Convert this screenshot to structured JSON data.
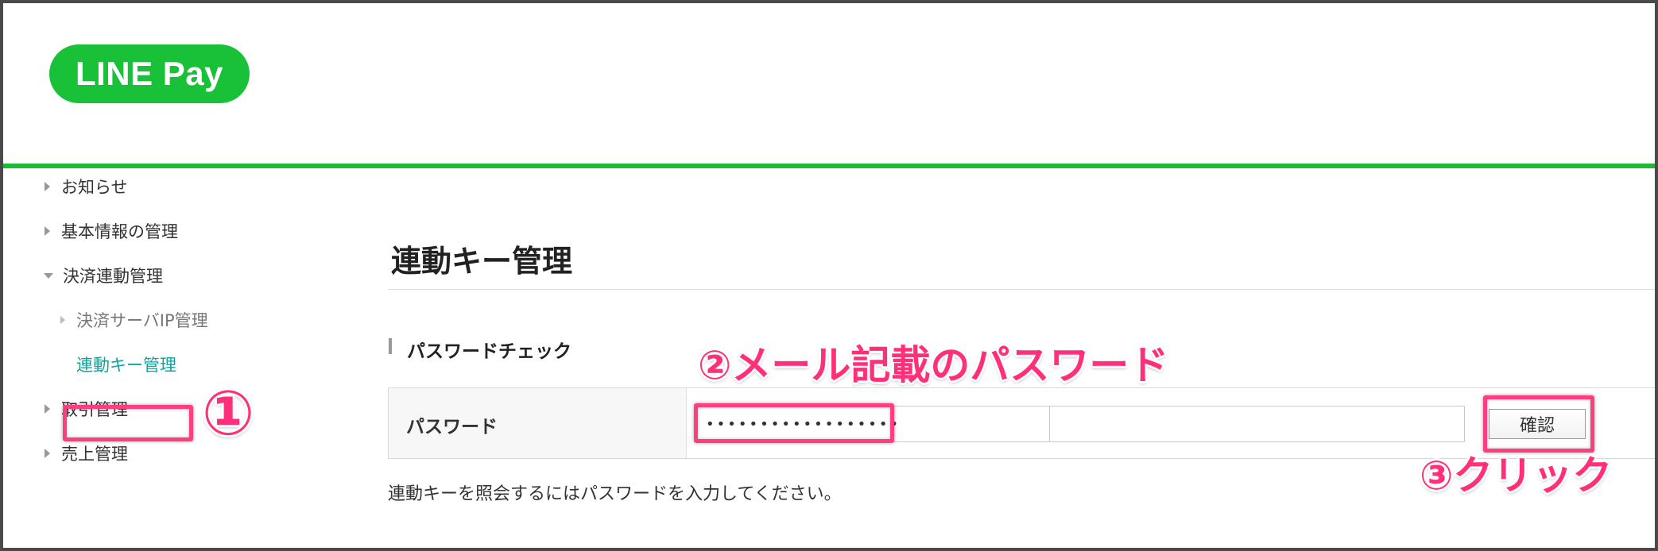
{
  "header": {
    "logo_text": "LINE Pay",
    "brand_color": "#19c139"
  },
  "sidebar": {
    "items": [
      {
        "label": "お知らせ"
      },
      {
        "label": "基本情報の管理"
      },
      {
        "label": "決済連動管理"
      },
      {
        "label": "決済サーバIP管理"
      },
      {
        "label": "連動キー管理"
      },
      {
        "label": "取引管理"
      },
      {
        "label": "売上管理"
      }
    ],
    "active_color": "#0aa6a0"
  },
  "main": {
    "title": "連動キー管理",
    "section_title": "パスワードチェック",
    "form": {
      "password_label": "パスワード",
      "password_value": "••••••••••••••••••",
      "confirm_label": "確認"
    },
    "help_text": "連動キーを照会するにはパスワードを入力してください。"
  },
  "annotations": {
    "step1": "①",
    "step2": "②メール記載のパスワード",
    "step3": "③クリック",
    "highlight_color": "#ff3d7f"
  }
}
